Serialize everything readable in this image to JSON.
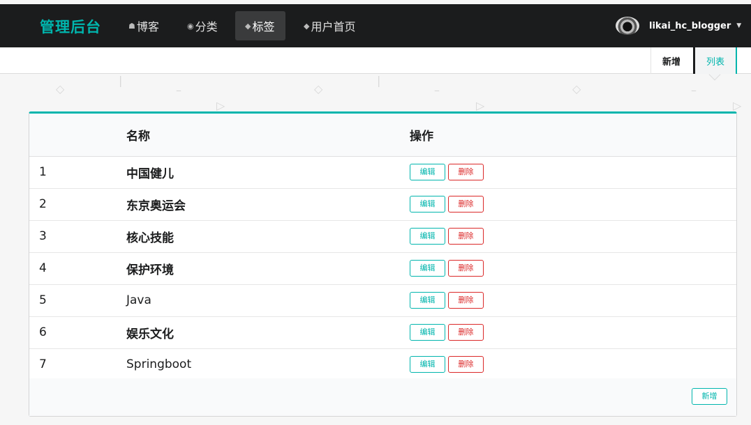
{
  "brand": "管理后台",
  "nav": [
    {
      "icon": "home-icon",
      "glyph": "☗",
      "label": "博客"
    },
    {
      "icon": "idea-icon",
      "glyph": "◉",
      "label": "分类"
    },
    {
      "icon": "tag-icon",
      "glyph": "◆",
      "label": "标签"
    },
    {
      "icon": "tags-icon",
      "glyph": "◆",
      "label": "用户首页"
    }
  ],
  "user": {
    "name": "likai_hc_blogger",
    "caret": "▼"
  },
  "submenu": {
    "new": "新增",
    "list": "列表"
  },
  "table": {
    "headers": [
      "",
      "名称",
      "操作"
    ],
    "rows": [
      {
        "id": "1",
        "name": "中国健儿"
      },
      {
        "id": "2",
        "name": "东京奥运会"
      },
      {
        "id": "3",
        "name": "核心技能"
      },
      {
        "id": "4",
        "name": "保护环境"
      },
      {
        "id": "5",
        "name": "Java"
      },
      {
        "id": "6",
        "name": "娱乐文化"
      },
      {
        "id": "7",
        "name": "Springboot"
      }
    ],
    "edit_label": "编辑",
    "delete_label": "删除",
    "add_label": "新增"
  },
  "colors": {
    "accent": "#00b5ad",
    "danger": "#db2828",
    "navbar": "#1b1c1d"
  }
}
